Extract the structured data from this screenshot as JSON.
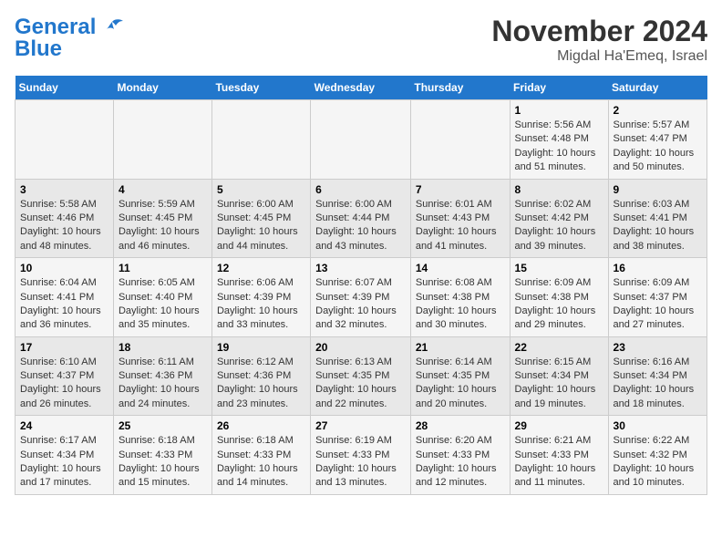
{
  "header": {
    "logo": {
      "line1": "General",
      "line2": "Blue"
    },
    "title": "November 2024",
    "subtitle": "Migdal Ha'Emeq, Israel"
  },
  "weekdays": [
    "Sunday",
    "Monday",
    "Tuesday",
    "Wednesday",
    "Thursday",
    "Friday",
    "Saturday"
  ],
  "weeks": [
    [
      {
        "day": "",
        "info": ""
      },
      {
        "day": "",
        "info": ""
      },
      {
        "day": "",
        "info": ""
      },
      {
        "day": "",
        "info": ""
      },
      {
        "day": "",
        "info": ""
      },
      {
        "day": "1",
        "info": "Sunrise: 5:56 AM\nSunset: 4:48 PM\nDaylight: 10 hours and 51 minutes."
      },
      {
        "day": "2",
        "info": "Sunrise: 5:57 AM\nSunset: 4:47 PM\nDaylight: 10 hours and 50 minutes."
      }
    ],
    [
      {
        "day": "3",
        "info": "Sunrise: 5:58 AM\nSunset: 4:46 PM\nDaylight: 10 hours and 48 minutes."
      },
      {
        "day": "4",
        "info": "Sunrise: 5:59 AM\nSunset: 4:45 PM\nDaylight: 10 hours and 46 minutes."
      },
      {
        "day": "5",
        "info": "Sunrise: 6:00 AM\nSunset: 4:45 PM\nDaylight: 10 hours and 44 minutes."
      },
      {
        "day": "6",
        "info": "Sunrise: 6:00 AM\nSunset: 4:44 PM\nDaylight: 10 hours and 43 minutes."
      },
      {
        "day": "7",
        "info": "Sunrise: 6:01 AM\nSunset: 4:43 PM\nDaylight: 10 hours and 41 minutes."
      },
      {
        "day": "8",
        "info": "Sunrise: 6:02 AM\nSunset: 4:42 PM\nDaylight: 10 hours and 39 minutes."
      },
      {
        "day": "9",
        "info": "Sunrise: 6:03 AM\nSunset: 4:41 PM\nDaylight: 10 hours and 38 minutes."
      }
    ],
    [
      {
        "day": "10",
        "info": "Sunrise: 6:04 AM\nSunset: 4:41 PM\nDaylight: 10 hours and 36 minutes."
      },
      {
        "day": "11",
        "info": "Sunrise: 6:05 AM\nSunset: 4:40 PM\nDaylight: 10 hours and 35 minutes."
      },
      {
        "day": "12",
        "info": "Sunrise: 6:06 AM\nSunset: 4:39 PM\nDaylight: 10 hours and 33 minutes."
      },
      {
        "day": "13",
        "info": "Sunrise: 6:07 AM\nSunset: 4:39 PM\nDaylight: 10 hours and 32 minutes."
      },
      {
        "day": "14",
        "info": "Sunrise: 6:08 AM\nSunset: 4:38 PM\nDaylight: 10 hours and 30 minutes."
      },
      {
        "day": "15",
        "info": "Sunrise: 6:09 AM\nSunset: 4:38 PM\nDaylight: 10 hours and 29 minutes."
      },
      {
        "day": "16",
        "info": "Sunrise: 6:09 AM\nSunset: 4:37 PM\nDaylight: 10 hours and 27 minutes."
      }
    ],
    [
      {
        "day": "17",
        "info": "Sunrise: 6:10 AM\nSunset: 4:37 PM\nDaylight: 10 hours and 26 minutes."
      },
      {
        "day": "18",
        "info": "Sunrise: 6:11 AM\nSunset: 4:36 PM\nDaylight: 10 hours and 24 minutes."
      },
      {
        "day": "19",
        "info": "Sunrise: 6:12 AM\nSunset: 4:36 PM\nDaylight: 10 hours and 23 minutes."
      },
      {
        "day": "20",
        "info": "Sunrise: 6:13 AM\nSunset: 4:35 PM\nDaylight: 10 hours and 22 minutes."
      },
      {
        "day": "21",
        "info": "Sunrise: 6:14 AM\nSunset: 4:35 PM\nDaylight: 10 hours and 20 minutes."
      },
      {
        "day": "22",
        "info": "Sunrise: 6:15 AM\nSunset: 4:34 PM\nDaylight: 10 hours and 19 minutes."
      },
      {
        "day": "23",
        "info": "Sunrise: 6:16 AM\nSunset: 4:34 PM\nDaylight: 10 hours and 18 minutes."
      }
    ],
    [
      {
        "day": "24",
        "info": "Sunrise: 6:17 AM\nSunset: 4:34 PM\nDaylight: 10 hours and 17 minutes."
      },
      {
        "day": "25",
        "info": "Sunrise: 6:18 AM\nSunset: 4:33 PM\nDaylight: 10 hours and 15 minutes."
      },
      {
        "day": "26",
        "info": "Sunrise: 6:18 AM\nSunset: 4:33 PM\nDaylight: 10 hours and 14 minutes."
      },
      {
        "day": "27",
        "info": "Sunrise: 6:19 AM\nSunset: 4:33 PM\nDaylight: 10 hours and 13 minutes."
      },
      {
        "day": "28",
        "info": "Sunrise: 6:20 AM\nSunset: 4:33 PM\nDaylight: 10 hours and 12 minutes."
      },
      {
        "day": "29",
        "info": "Sunrise: 6:21 AM\nSunset: 4:33 PM\nDaylight: 10 hours and 11 minutes."
      },
      {
        "day": "30",
        "info": "Sunrise: 6:22 AM\nSunset: 4:32 PM\nDaylight: 10 hours and 10 minutes."
      }
    ]
  ]
}
